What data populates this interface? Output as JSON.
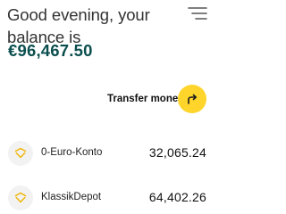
{
  "header": {
    "greeting": "Good evening, your balance is",
    "balance": "€96,467.50",
    "menu_icon": "menu-icon"
  },
  "transfer": {
    "label": "Transfer money",
    "icon": "arrow-forward-icon",
    "button_color": "#ffd52b"
  },
  "accounts": [
    {
      "name": "0-Euro-Konto",
      "balance": "32,065.24",
      "icon": "bank-logo-icon"
    },
    {
      "name": "KlassikDepot",
      "balance": "64,402.26",
      "icon": "bank-logo-icon"
    }
  ],
  "colors": {
    "balance_text": "#0b4e4e",
    "accent_yellow": "#ffd52b"
  }
}
